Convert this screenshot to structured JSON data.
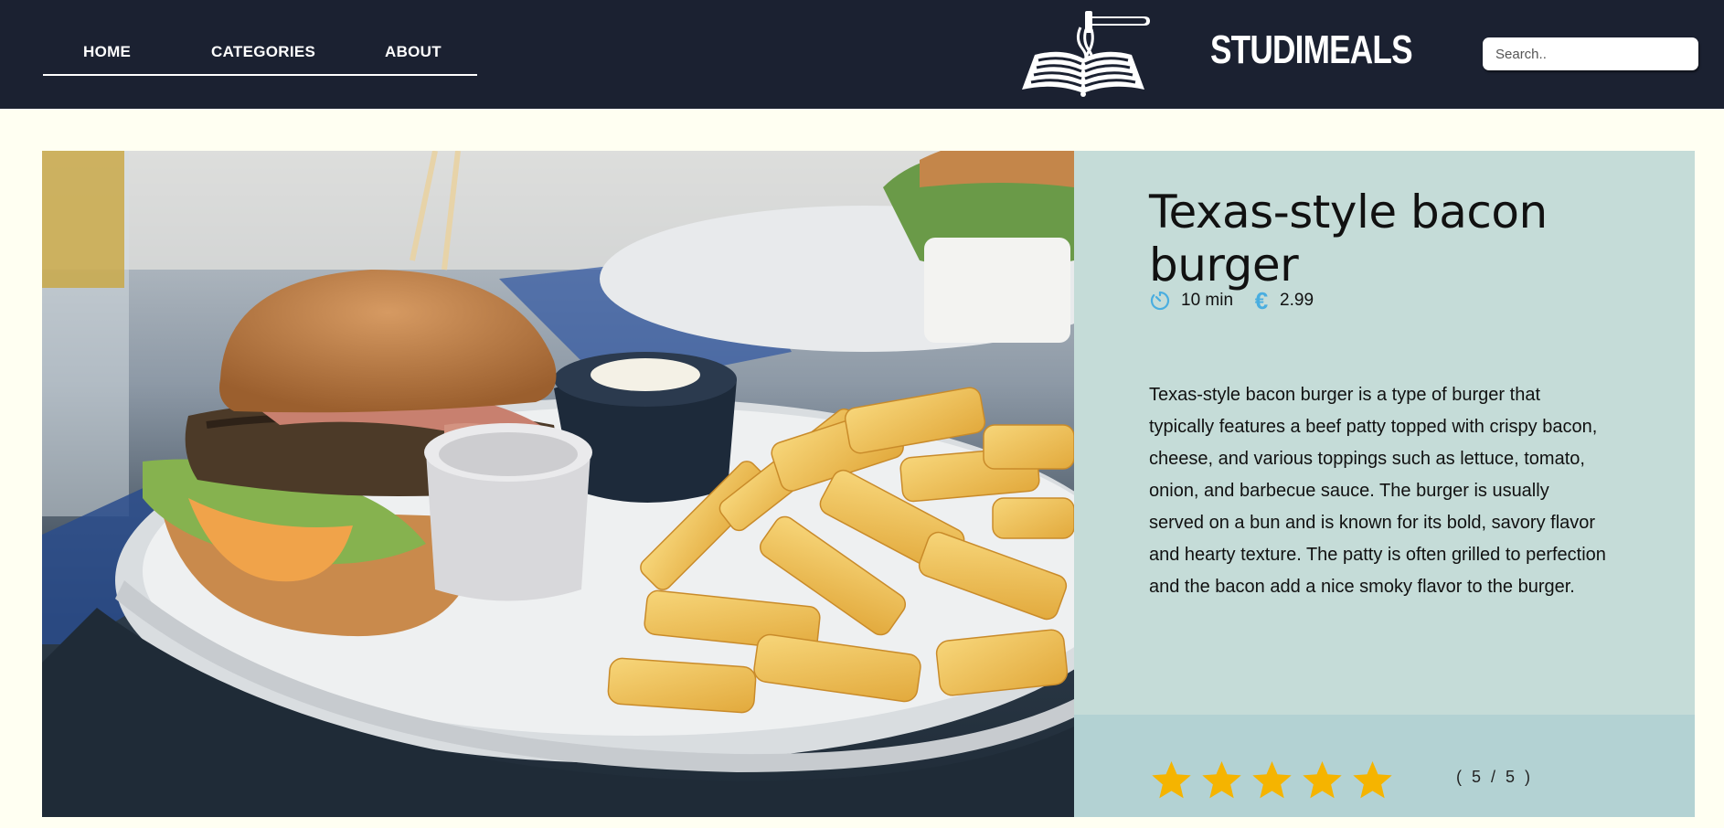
{
  "nav": {
    "links": [
      {
        "label": "HOME"
      },
      {
        "label": "CATEGORIES"
      },
      {
        "label": "ABOUT"
      }
    ],
    "brand": "STUDIMEALS",
    "logo_icon": "book-fork-icon",
    "search": {
      "placeholder": "Search..",
      "value": ""
    }
  },
  "recipe": {
    "title": "Texas-style bacon burger",
    "time": "10 min",
    "time_icon": "timer-icon",
    "price": "2.99",
    "currency_symbol": "€",
    "price_icon": "euro-icon",
    "description": "Texas-style bacon burger is a type of burger that typically features a beef patty topped with crispy bacon, cheese, and various toppings such as lettuce, tomato, onion, and barbecue sauce. The burger is usually served on a bun and is known for its bold, savory flavor and hearty texture. The patty is often grilled to perfection and the bacon add a nice smoky flavor to the burger.",
    "image": "burger-and-fries-photo",
    "rating": {
      "value": 5,
      "max": 5,
      "label": "( 5 / 5 )",
      "star_icon": "star-icon"
    }
  },
  "colors": {
    "nav_bg": "#1b2131",
    "page_bg": "#fffff2",
    "info_bg": "#c5dcd8",
    "rating_bg": "#b3d2d3",
    "accent_blue": "#4aaee0",
    "star": "#f5b400"
  }
}
